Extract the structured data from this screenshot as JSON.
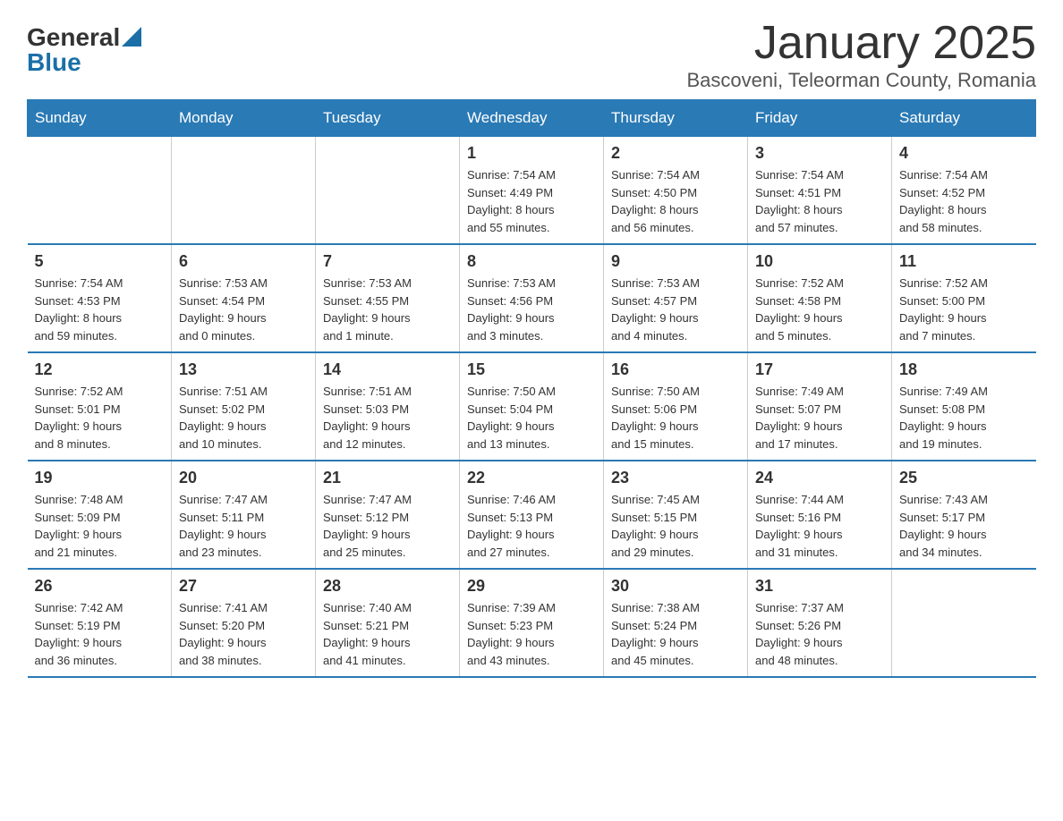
{
  "header": {
    "logo": {
      "general": "General",
      "blue": "Blue",
      "triangle_aria": "logo triangle"
    },
    "title": "January 2025",
    "location": "Bascoveni, Teleorman County, Romania"
  },
  "calendar": {
    "days_of_week": [
      "Sunday",
      "Monday",
      "Tuesday",
      "Wednesday",
      "Thursday",
      "Friday",
      "Saturday"
    ],
    "weeks": [
      [
        {
          "day": "",
          "info": ""
        },
        {
          "day": "",
          "info": ""
        },
        {
          "day": "",
          "info": ""
        },
        {
          "day": "1",
          "info": "Sunrise: 7:54 AM\nSunset: 4:49 PM\nDaylight: 8 hours\nand 55 minutes."
        },
        {
          "day": "2",
          "info": "Sunrise: 7:54 AM\nSunset: 4:50 PM\nDaylight: 8 hours\nand 56 minutes."
        },
        {
          "day": "3",
          "info": "Sunrise: 7:54 AM\nSunset: 4:51 PM\nDaylight: 8 hours\nand 57 minutes."
        },
        {
          "day": "4",
          "info": "Sunrise: 7:54 AM\nSunset: 4:52 PM\nDaylight: 8 hours\nand 58 minutes."
        }
      ],
      [
        {
          "day": "5",
          "info": "Sunrise: 7:54 AM\nSunset: 4:53 PM\nDaylight: 8 hours\nand 59 minutes."
        },
        {
          "day": "6",
          "info": "Sunrise: 7:53 AM\nSunset: 4:54 PM\nDaylight: 9 hours\nand 0 minutes."
        },
        {
          "day": "7",
          "info": "Sunrise: 7:53 AM\nSunset: 4:55 PM\nDaylight: 9 hours\nand 1 minute."
        },
        {
          "day": "8",
          "info": "Sunrise: 7:53 AM\nSunset: 4:56 PM\nDaylight: 9 hours\nand 3 minutes."
        },
        {
          "day": "9",
          "info": "Sunrise: 7:53 AM\nSunset: 4:57 PM\nDaylight: 9 hours\nand 4 minutes."
        },
        {
          "day": "10",
          "info": "Sunrise: 7:52 AM\nSunset: 4:58 PM\nDaylight: 9 hours\nand 5 minutes."
        },
        {
          "day": "11",
          "info": "Sunrise: 7:52 AM\nSunset: 5:00 PM\nDaylight: 9 hours\nand 7 minutes."
        }
      ],
      [
        {
          "day": "12",
          "info": "Sunrise: 7:52 AM\nSunset: 5:01 PM\nDaylight: 9 hours\nand 8 minutes."
        },
        {
          "day": "13",
          "info": "Sunrise: 7:51 AM\nSunset: 5:02 PM\nDaylight: 9 hours\nand 10 minutes."
        },
        {
          "day": "14",
          "info": "Sunrise: 7:51 AM\nSunset: 5:03 PM\nDaylight: 9 hours\nand 12 minutes."
        },
        {
          "day": "15",
          "info": "Sunrise: 7:50 AM\nSunset: 5:04 PM\nDaylight: 9 hours\nand 13 minutes."
        },
        {
          "day": "16",
          "info": "Sunrise: 7:50 AM\nSunset: 5:06 PM\nDaylight: 9 hours\nand 15 minutes."
        },
        {
          "day": "17",
          "info": "Sunrise: 7:49 AM\nSunset: 5:07 PM\nDaylight: 9 hours\nand 17 minutes."
        },
        {
          "day": "18",
          "info": "Sunrise: 7:49 AM\nSunset: 5:08 PM\nDaylight: 9 hours\nand 19 minutes."
        }
      ],
      [
        {
          "day": "19",
          "info": "Sunrise: 7:48 AM\nSunset: 5:09 PM\nDaylight: 9 hours\nand 21 minutes."
        },
        {
          "day": "20",
          "info": "Sunrise: 7:47 AM\nSunset: 5:11 PM\nDaylight: 9 hours\nand 23 minutes."
        },
        {
          "day": "21",
          "info": "Sunrise: 7:47 AM\nSunset: 5:12 PM\nDaylight: 9 hours\nand 25 minutes."
        },
        {
          "day": "22",
          "info": "Sunrise: 7:46 AM\nSunset: 5:13 PM\nDaylight: 9 hours\nand 27 minutes."
        },
        {
          "day": "23",
          "info": "Sunrise: 7:45 AM\nSunset: 5:15 PM\nDaylight: 9 hours\nand 29 minutes."
        },
        {
          "day": "24",
          "info": "Sunrise: 7:44 AM\nSunset: 5:16 PM\nDaylight: 9 hours\nand 31 minutes."
        },
        {
          "day": "25",
          "info": "Sunrise: 7:43 AM\nSunset: 5:17 PM\nDaylight: 9 hours\nand 34 minutes."
        }
      ],
      [
        {
          "day": "26",
          "info": "Sunrise: 7:42 AM\nSunset: 5:19 PM\nDaylight: 9 hours\nand 36 minutes."
        },
        {
          "day": "27",
          "info": "Sunrise: 7:41 AM\nSunset: 5:20 PM\nDaylight: 9 hours\nand 38 minutes."
        },
        {
          "day": "28",
          "info": "Sunrise: 7:40 AM\nSunset: 5:21 PM\nDaylight: 9 hours\nand 41 minutes."
        },
        {
          "day": "29",
          "info": "Sunrise: 7:39 AM\nSunset: 5:23 PM\nDaylight: 9 hours\nand 43 minutes."
        },
        {
          "day": "30",
          "info": "Sunrise: 7:38 AM\nSunset: 5:24 PM\nDaylight: 9 hours\nand 45 minutes."
        },
        {
          "day": "31",
          "info": "Sunrise: 7:37 AM\nSunset: 5:26 PM\nDaylight: 9 hours\nand 48 minutes."
        },
        {
          "day": "",
          "info": ""
        }
      ]
    ]
  }
}
